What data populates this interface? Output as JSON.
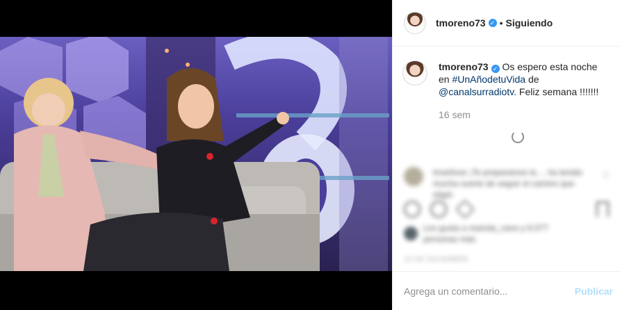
{
  "header": {
    "username": "tmoreno73",
    "verified_glyph": "✓",
    "separator": "•",
    "follow_status": "Siguiendo"
  },
  "caption": {
    "username": "tmoreno73",
    "text_before": " Os espero esta noche en ",
    "hashtag": "#UnAñodetuVida",
    "text_mid": " de ",
    "mention": "@canalsurradiotv",
    "text_after": ". Feliz semana !!!!!!!",
    "time": "16 sem"
  },
  "blurred_comment": "tmarilove ¡Te preparamos la ... ha tenido mucha suerte de seguir el camino que eligió",
  "blurred_likes": "Les gusta a mariola_cano y 6.077 personas más",
  "blurred_date": "16 DE DICIEMBRE",
  "comment_box": {
    "placeholder": "Agrega un comentario...",
    "publish_label": "Publicar"
  },
  "icons": [
    "verified-icon",
    "heart-icon",
    "comment-icon",
    "share-icon",
    "bookmark-icon",
    "loading-spinner-icon"
  ],
  "colors": {
    "link": "#00376b",
    "verified": "#3897f0",
    "publish_disabled": "#b2dffc",
    "muted": "#8e8e8e"
  }
}
